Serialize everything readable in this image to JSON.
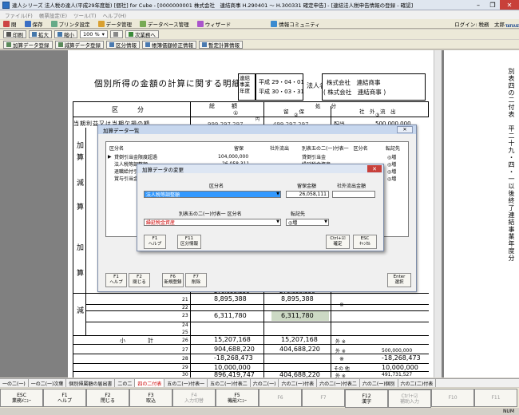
{
  "window": {
    "title": "達人シリーズ 法人税の達人(平成29年度版) [個社] for Cube - [0000000001 株式会社　連結商事 H.290401 ～ H.300331 確定申告] - [連結法人税申告情報の登録 - 確認]"
  },
  "menu": [
    "ファイル(F)",
    "帳票設定(E)",
    "ツール(T)",
    "ヘルプ(H)"
  ],
  "toolbar1": {
    "items": [
      "閉",
      "保存",
      "プリンタ設定",
      "データ管理",
      "データベース管理",
      "ウィザード",
      "情報コミュニティ"
    ],
    "login": "ログイン: 税務　太郎",
    "brand": "TATSUZIN"
  },
  "toolbar2": {
    "items": [
      "印刷",
      "拡大",
      "縮小",
      "次業務へ"
    ],
    "zoom": "100 %"
  },
  "toolbar3": {
    "items": [
      "加算データ登録",
      "減算データ登録",
      "区分情報",
      "帳簿価額修正情報",
      "暫定計算情報"
    ]
  },
  "document": {
    "title": "個別所得の金額の計算に関する明細書",
    "consolidated_label": "連結事業年度",
    "period_from": "平成 29・04・01",
    "period_to": "平成 30・03・31",
    "corp_label": "法人名",
    "corp_name_1": "株式会社　連結商事",
    "corp_name_2": "( 株式会社　連結商事 )",
    "form_side": "別表四の二付表　平二十九・四・一以後終了連結事業年度分",
    "col_kubun": "区　　　分",
    "col_sougaku": "総　　　額",
    "col_shobun": "処　　分",
    "col_ryuho": "留　　保",
    "col_shagai": "社　外　流　出",
    "col_num1": "①",
    "col_num2": "②",
    "col_num3": "③",
    "row_toukimei": "当期利益又は当期欠損の額",
    "row_toukimei_v1": "999,297,297",
    "row_toukimei_v2": "499,297,297",
    "row_haitou": "配当",
    "row_haitou_v": "500,000,000",
    "yen": "円",
    "side_kasan": "加",
    "side_san": "算",
    "side_gen": "減",
    "row_a": "276,058,356",
    "row_a2": "276,058,356",
    "r21_v": "8,895,388",
    "r21_v2": "8,895,388",
    "r23_v": "6,311,780",
    "r23_v2": "6,311,780",
    "r26_label": "小　　　　計",
    "r26_v": "15,207,168",
    "r26_v2": "15,207,168",
    "r27_v": "904,688,220",
    "r27_v2": "404,688,220",
    "r27_gai": "外 ※",
    "r27_v3": "500,000,000",
    "r28_v": "-18,268,473",
    "r28_v3": "-18,268,473",
    "r29_v": "10,000,000",
    "r29_gai": "その 他",
    "r29_v3": "10,000,000",
    "r30_v": "896,419,747",
    "r30_v2": "404,688,220",
    "r30_gai": "外 ※",
    "r30_v3": "491,731,527",
    "rownums": [
      "21",
      "22",
      "23",
      "24",
      "25",
      "26",
      "27",
      "28",
      "29",
      "30"
    ]
  },
  "dialog_list": {
    "title": "加算データ一覧",
    "headers": [
      "区分名",
      "留保",
      "社外流出",
      "別表五の二(一)付表一　区分名",
      "転記先"
    ],
    "rows": [
      {
        "name": "貸倒引当金限度超過",
        "ryuho": "104,000,000",
        "shagai": "",
        "beppyo": "貸倒引当金",
        "tenki": "◎増"
      },
      {
        "name": "法人税等調整額",
        "ryuho": "26,058,311",
        "shagai": "",
        "beppyo": "繰延税金資産",
        "tenki": "◎増"
      },
      {
        "name": "退職給付引当金",
        "ryuho": "",
        "shagai": "",
        "beppyo": "",
        "tenki": "◎増"
      },
      {
        "name": "賞与引当金繰入",
        "ryuho": "",
        "shagai": "",
        "beppyo": "",
        "tenki": "◎増"
      }
    ],
    "buttons": [
      {
        "key": "F1",
        "label": "ヘルプ"
      },
      {
        "key": "F2",
        "label": "閉じる"
      },
      {
        "key": "F6",
        "label": "新規登録"
      },
      {
        "key": "F7",
        "label": "削除"
      },
      {
        "key": "Enter",
        "label": "選択"
      }
    ]
  },
  "dialog_edit": {
    "title": "加算データの変更",
    "label_kubun": "区分名",
    "label_ryuho": "留保金額",
    "label_shagai": "社外流出金額",
    "kubun_value": "法人税等調整額",
    "ryuho_value": "26,058,111",
    "shagai_value": "",
    "label_beppyo": "別表五の二(一)付表一 区分名",
    "label_tenki": "転記先",
    "beppyo_value": "繰延税金資産",
    "tenki_value": "◎増",
    "buttons": [
      {
        "key": "F1",
        "label": "ヘルプ"
      },
      {
        "key": "F11",
        "label": "区分情報"
      },
      {
        "key": "Ctrl+☑",
        "label": "確定"
      },
      {
        "key": "ESC",
        "label": "ｷｬﾝｾﾙ"
      }
    ]
  },
  "tabs": [
    "一の二(一)",
    "一の二(一)次葉",
    "個別帰属額の届出書",
    "二の二",
    "四の二付表",
    "五の二(一)付表一",
    "五の二(一)付表二",
    "六の二(一)",
    "六の二(一)付表",
    "六の二(一)付表二",
    "六の二(一)個別",
    "六の二(二)付表"
  ],
  "active_tab": "四の二付表",
  "fkeys": [
    {
      "key": "ESC",
      "label": "業務ﾒﾆｭｰ",
      "disabled": false
    },
    {
      "key": "F1",
      "label": "ヘルプ",
      "disabled": false
    },
    {
      "key": "F2",
      "label": "閉じる",
      "disabled": false
    },
    {
      "key": "F3",
      "label": "取込",
      "disabled": false
    },
    {
      "key": "F4",
      "label": "入力切替",
      "disabled": true
    },
    {
      "key": "F5",
      "label": "機能ﾒﾆｭｰ",
      "disabled": false
    },
    {
      "key": "F6",
      "label": "",
      "disabled": true
    },
    {
      "key": "F7",
      "label": "",
      "disabled": true
    },
    {
      "key": "F8",
      "label": "",
      "disabled": true
    },
    {
      "key": "F9",
      "label": "",
      "disabled": true
    },
    {
      "key": "F10",
      "label": "",
      "disabled": true
    },
    {
      "key": "F11",
      "label": "",
      "disabled": true
    },
    {
      "key": "F12",
      "label": "漢字",
      "disabled": false
    },
    {
      "key": "Ctrl+☑",
      "label": "補助入力",
      "disabled": true
    }
  ],
  "status": {
    "num": "NUM"
  }
}
